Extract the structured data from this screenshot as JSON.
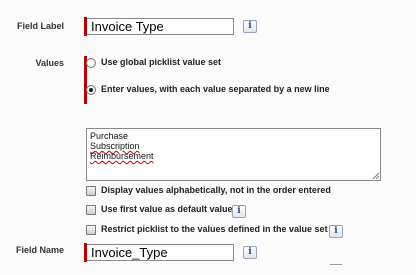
{
  "field_label": {
    "label": "Field Label",
    "value": "Invoice Type",
    "help_icon": "info-icon",
    "help_glyph": "i"
  },
  "values": {
    "label": "Values",
    "option_global": "Use global picklist value set",
    "option_enter": "Enter values, with each value separated by a new line",
    "selected": "option_enter",
    "entries": [
      "Purchase",
      "Subscription",
      "Reimbursement"
    ]
  },
  "checkboxes": {
    "alphabetical": "Display values alphabetically, not in the order entered",
    "first_default": "Use first value as default value",
    "restrict": "Restrict picklist to the values defined in the value set"
  },
  "field_name": {
    "label": "Field Name",
    "value": "Invoice_Type",
    "help_icon": "info-icon",
    "help_glyph": "i"
  },
  "colors": {
    "required_bar": "#c00000",
    "info_text": "#1f4d8c",
    "spellcheck": "#d00000"
  }
}
